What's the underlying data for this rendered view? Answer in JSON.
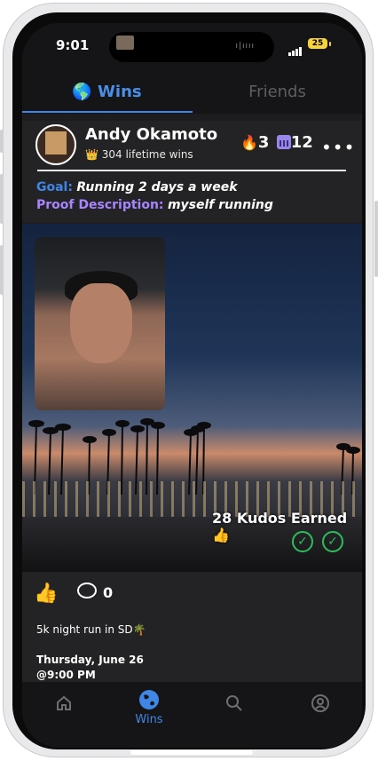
{
  "status_bar": {
    "time": "9:01",
    "battery": "25"
  },
  "tabs": [
    {
      "label": "🌎 Wins",
      "active": true
    },
    {
      "label": "Friends",
      "active": false
    }
  ],
  "post": {
    "username": "Andy Okamoto",
    "lifetime_wins": "👑 304 lifetime wins",
    "streak": "3",
    "days": "12",
    "goal_label": "Goal:",
    "goal_value": "Running 2 days a week",
    "proof_label": "Proof Description:",
    "proof_value": "myself running",
    "kudos_text": "28 Kudos Earned",
    "comment_count": "0",
    "caption": "5k night run in SD🌴",
    "date": "Thursday, June 26",
    "time": "@9:00 PM"
  },
  "bottom_nav": [
    {
      "label": "",
      "icon": "home-icon"
    },
    {
      "label": "Wins",
      "icon": "globe-icon"
    },
    {
      "label": "",
      "icon": "search-icon"
    },
    {
      "label": "",
      "icon": "profile-icon"
    }
  ],
  "colors": {
    "accent": "#3f86e6",
    "proof": "#a884ff",
    "check": "#2dbd5a",
    "background": "#1d1d1f"
  }
}
